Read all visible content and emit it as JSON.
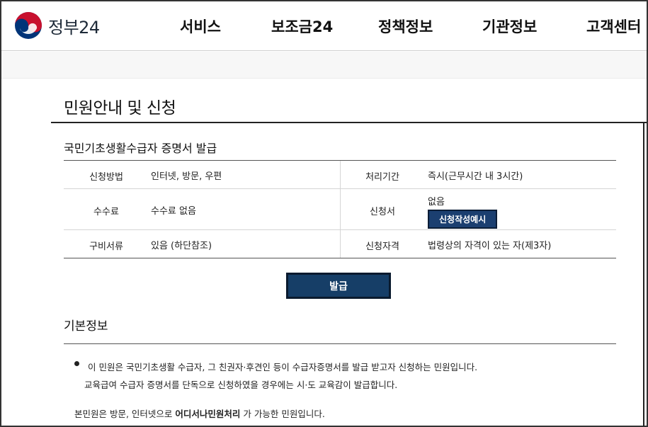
{
  "header": {
    "logo_text": "정부24",
    "nav": [
      "서비스",
      "보조금24",
      "정책정보",
      "기관정보",
      "고객센터"
    ]
  },
  "page": {
    "title": "민원안내 및 신청",
    "service_title": "국민기초생활수급자 증명서 발급"
  },
  "info": {
    "method_label": "신청방법",
    "method_value": "인터넷, 방문, 우편",
    "period_label": "처리기간",
    "period_value": "즉시(근무시간 내 3시간)",
    "fee_label": "수수료",
    "fee_value": "수수료 없음",
    "form_label": "신청서",
    "form_value": "없음",
    "form_button": "신청작성예시",
    "docs_label": "구비서류",
    "docs_value": "있음 (하단참조)",
    "qual_label": "신청자격",
    "qual_value": "법령상의 자격이 있는 자(제3자)"
  },
  "issue_button": "발급",
  "basic": {
    "title": "기본정보",
    "line1": "이 민원은 국민기초생활 수급자, 그 친권자·후견인 등이 수급자증명서를 발급 받고자 신청하는 민원입니다.",
    "line2": "교육급여 수급자 증명서를 단독으로 신청하였을 경우에는 시·도 교육감이 발급합니다.",
    "line3_pre": "본민원은 방문, 인터넷으로 ",
    "line3_bold": "어디서나민원처리",
    "line3_post": " 가 가능한 민원입니다."
  },
  "colors": {
    "brand_navy": "#163e67",
    "logo_red": "#c8102e",
    "logo_blue": "#003478"
  }
}
